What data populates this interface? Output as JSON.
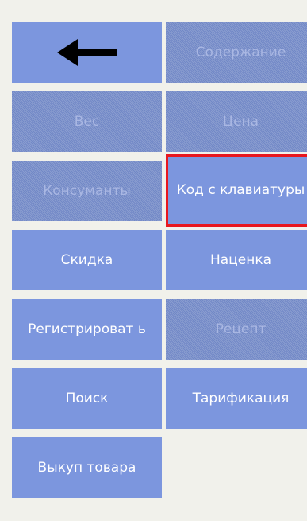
{
  "buttons": {
    "back": {
      "icon": "back-arrow-icon"
    },
    "content": {
      "label": "Содержание"
    },
    "weight": {
      "label": "Вес"
    },
    "price": {
      "label": "Цена"
    },
    "consumables": {
      "label": "Консуманты"
    },
    "keyboard_code": {
      "label": "Код с клавиатуры"
    },
    "discount": {
      "label": "Скидка"
    },
    "markup": {
      "label": "Наценка"
    },
    "register": {
      "label": "Регистрироват ь"
    },
    "recipe": {
      "label": "Рецепт"
    },
    "search": {
      "label": "Поиск"
    },
    "tariffing": {
      "label": "Тарификация"
    },
    "buyback": {
      "label": "Выкуп товара"
    }
  },
  "colors": {
    "button": "#7c96de",
    "selected_border": "#e8171e",
    "background": "#f1f1eb"
  }
}
